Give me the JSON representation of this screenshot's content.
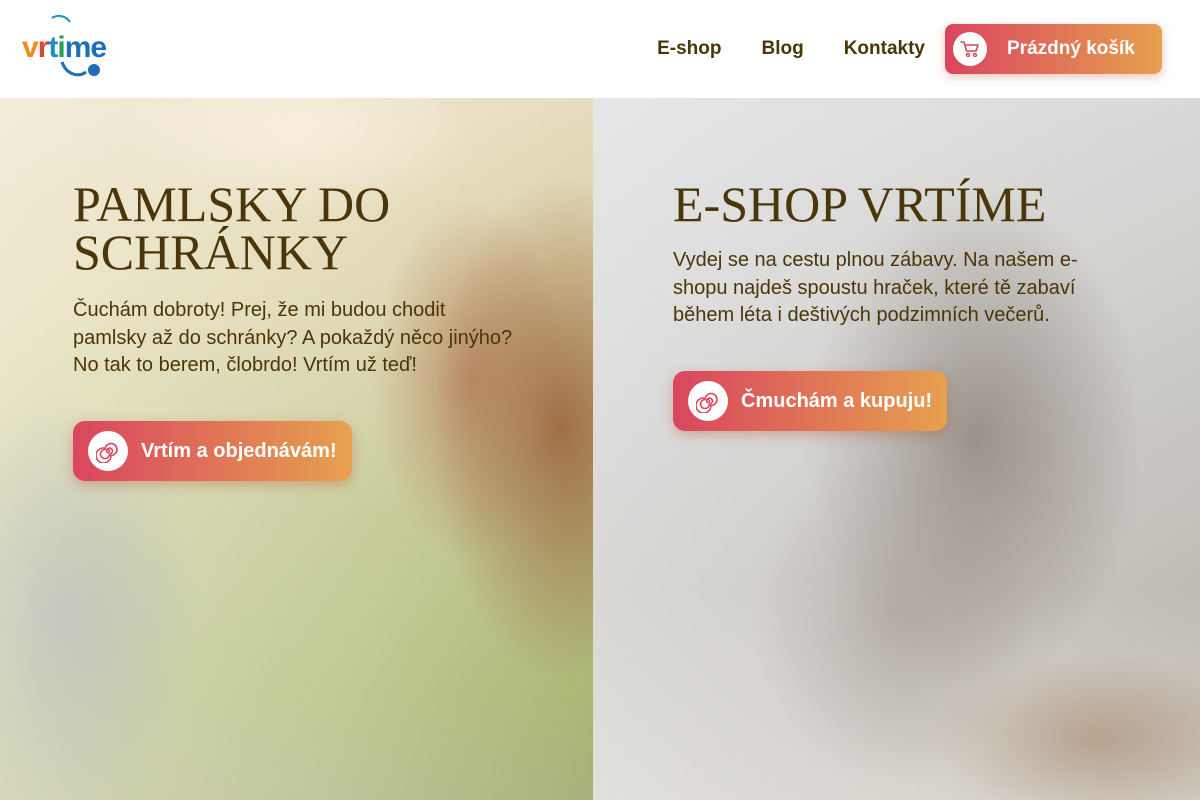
{
  "header": {
    "logo": {
      "part1": "v",
      "part2": "r",
      "part3": "t",
      "part4": "i",
      "part5": "me"
    },
    "nav": {
      "eshop": "E-shop",
      "blog": "Blog",
      "contacts": "Kontakty"
    },
    "cart": {
      "label": "Prázdný košík",
      "icon": "cart-icon"
    }
  },
  "hero_left": {
    "title_line1": "PAMLSKY DO",
    "title_line2": "SCHRÁNKY",
    "text": "Čuchám dobroty! Prej, že mi budou chodit pamlsky až do schránky? A pokaždý něco jinýho? No tak to berem, člobrdo! Vrtím už teď!",
    "cta": {
      "label": "Vrtím a objednávám!",
      "icon": "spiral-icon"
    },
    "image": "dog-receiving-treat-photo"
  },
  "hero_right": {
    "title": "E-SHOP VRTÍME",
    "text": "Vydej se na cestu plnou zábavy. Na našem e-shopu najdeš spoustu hraček, které tě zabaví během léta i deštivých podzimních večerů.",
    "cta": {
      "label": "Čmuchám a kupuju!",
      "icon": "spiral-icon"
    },
    "image": "tabby-cat-with-toy-photo"
  },
  "colors": {
    "text_brown": "#4a3608",
    "gradient_start": "#d9455f",
    "gradient_end": "#e6a14f"
  }
}
